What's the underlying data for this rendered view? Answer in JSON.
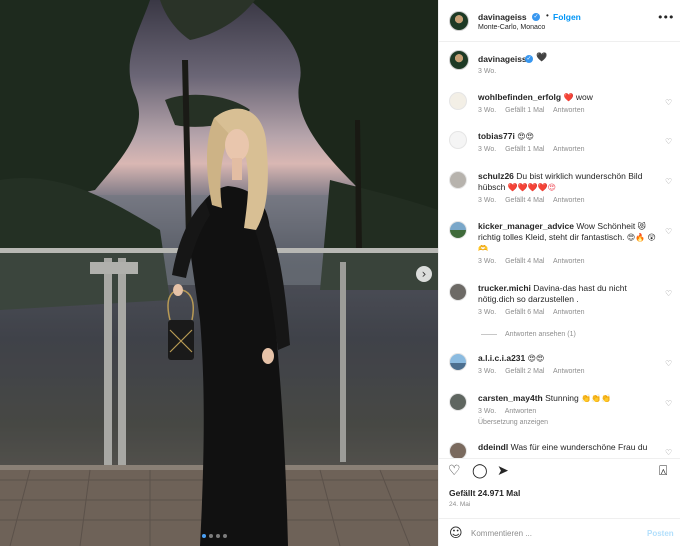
{
  "post": {
    "username": "davinageiss",
    "follow_label": "Folgen",
    "location": "Monte-Carlo, Monaco",
    "separator": "•",
    "more_icon": "more-horizontal-icon",
    "caption": {
      "username": "davinageiss",
      "emoji": "🖤",
      "time": "3 Wo."
    },
    "likes_text": "Gefällt 24.971 Mal",
    "date": "24. Mai",
    "carousel": {
      "slides": 4,
      "active_slide": 1
    }
  },
  "comments": [
    {
      "user": "wohlbefinden_erfolg",
      "text": "wow",
      "emoji_before_text": "❤️",
      "time": "3 Wo.",
      "likes": "Gefällt 1 Mal",
      "reply": "Antworten"
    },
    {
      "user": "tobias77i",
      "text": "",
      "emoji_after": "😍😍",
      "time": "3 Wo.",
      "likes": "Gefällt 1 Mal",
      "reply": "Antworten"
    },
    {
      "user": "schulz26",
      "text": "Du bist wirklich wunderschön Bild hübsch",
      "emoji_after": "❤️❤️❤️❤️😍",
      "time": "3 Wo.",
      "likes": "Gefällt 4 Mal",
      "reply": "Antworten"
    },
    {
      "user": "kicker_manager_advice",
      "text": "Wow Schönheit",
      "emoji_mid": "😻",
      "text2": "richtig tolles Kleid, steht dir fantastisch.",
      "emoji_after": "😍🔥",
      "emoji_line3": "😲🫶",
      "time": "3 Wo.",
      "likes": "Gefällt 4 Mal",
      "reply": "Antworten"
    },
    {
      "user": "trucker.michi",
      "text": "Davina-das hast du nicht nötig.dich so darzustellen .",
      "time": "3 Wo.",
      "likes": "Gefällt 6 Mal",
      "reply": "Antworten",
      "view_replies": "Antworten ansehen (1)"
    },
    {
      "user": "a.l.i.c.i.a231",
      "text": "",
      "emoji_after": "😍😍",
      "time": "3 Wo.",
      "likes": "Gefällt 2 Mal",
      "reply": "Antworten"
    },
    {
      "user": "carsten_may4th",
      "text": "Stunning",
      "emoji_after": "👏👏👏",
      "time": "3 Wo.",
      "reply": "Antworten",
      "translate": "Übersetzung anzeigen"
    },
    {
      "user": "ddeindl",
      "text": "Was für eine wunderschöne Frau du"
    }
  ],
  "compose": {
    "placeholder": "Kommentieren ...",
    "post_label": "Posten"
  },
  "colors": {
    "accent": "#0095f6",
    "verified": "#3897f0",
    "muted": "#8e8e8e",
    "heart": "#ed4956"
  },
  "icons": [
    "heart-icon",
    "comment-icon",
    "share-icon",
    "bookmark-icon",
    "emoji-icon",
    "chevron-right-icon"
  ]
}
